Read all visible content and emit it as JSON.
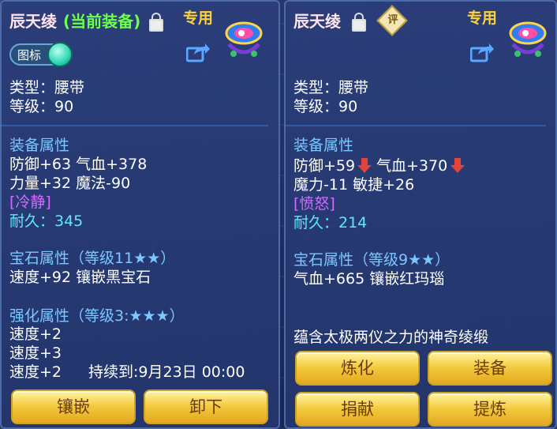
{
  "left": {
    "title": "辰天绫",
    "title_status": "(当前装备)",
    "tag": "专用",
    "toggle_label": "图标",
    "type_line": "类型：腰带",
    "level_line": "等级：90",
    "equip_attr_header": "装备属性",
    "attr_line1": "防御+63 气血+378",
    "attr_line2": "力量+32 魔法-90",
    "special": "[冷静]",
    "durability": "耐久：345",
    "gem_header": "宝石属性（等级11★★）",
    "gem_line": "速度+92 镶嵌黑宝石",
    "enhance_header": "强化属性（等级3:★★★）",
    "enhance_line1": "速度+2",
    "enhance_line2": "速度+3",
    "enhance_line3": "速度+2",
    "duration": "持续到:9月23日 00:00",
    "buttons": {
      "inlay": "镶嵌",
      "unequip": "卸下"
    }
  },
  "right": {
    "title": "辰天绫",
    "tag": "专用",
    "badge": "评",
    "type_line": "类型：腰带",
    "level_line": "等级：90",
    "equip_attr_header": "装备属性",
    "attr_defense": "防御+59",
    "attr_hp": "气血+370",
    "attr_line2": "魔力-11 敏捷+26",
    "special": "[愤怒]",
    "durability": "耐久：214",
    "gem_header": "宝石属性（等级9★★）",
    "gem_line": "气血+665 镶嵌红玛瑙",
    "description": "蕴含太极两仪之力的神奇绫缎",
    "buttons": {
      "refine": "炼化",
      "equip": "装备",
      "donate": "捐献",
      "extract": "提炼"
    }
  },
  "icons": [
    "lock-icon",
    "share-icon",
    "emblem-icon",
    "down-arrow-icon"
  ],
  "colors": {
    "panel_bg": "#24366e",
    "button_gold": "#f3c93c",
    "stat_white": "#ffffff",
    "header_blue": "#7cc7ff",
    "durability_cyan": "#5fe8ff",
    "special_purple": "#d46bff",
    "decrease_red": "#e2443d"
  }
}
